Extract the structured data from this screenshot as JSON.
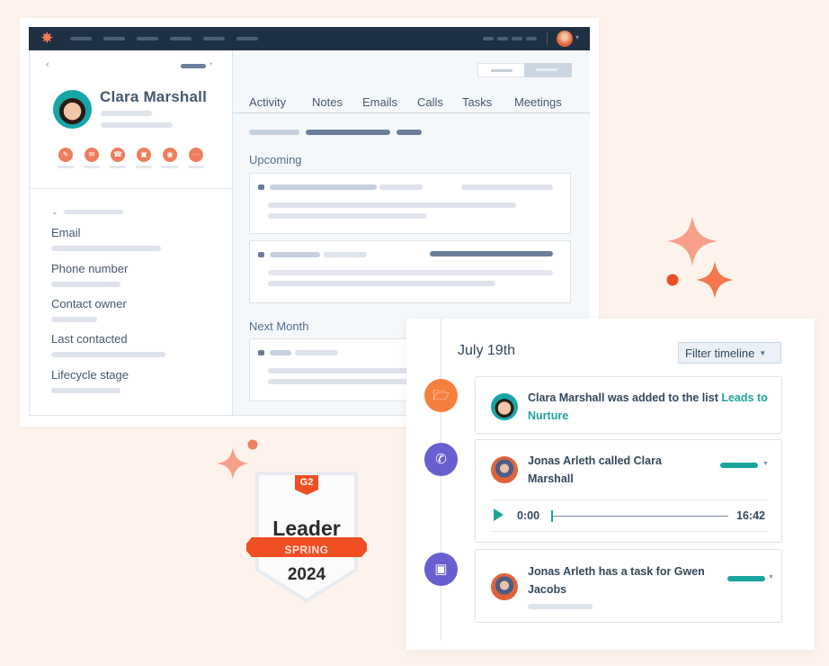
{
  "crm": {
    "logo_icon": "hubspot-sprocket-icon",
    "contact": {
      "name": "Clara Marshall",
      "action_icons": [
        "note-icon",
        "email-icon",
        "call-icon",
        "task-icon",
        "meeting-icon",
        "more-icon"
      ],
      "properties": [
        {
          "label": "Email"
        },
        {
          "label": "Phone number"
        },
        {
          "label": "Contact owner"
        },
        {
          "label": "Last contacted"
        },
        {
          "label": "Lifecycle stage"
        }
      ]
    },
    "tabs": [
      "Activity",
      "Notes",
      "Emails",
      "Calls",
      "Tasks",
      "Meetings"
    ],
    "sections": {
      "upcoming": "Upcoming",
      "next_month": "Next Month"
    }
  },
  "timeline": {
    "date": "July 19th",
    "filter_label": "Filter timeline",
    "events": [
      {
        "icon": "folder-icon",
        "icon_color": "#f5803e",
        "text": "Clara Marshall was added to the list ",
        "link": "Leads to Nurture"
      },
      {
        "icon": "phone-icon",
        "icon_color": "#6a5fd1",
        "text": "Jonas Arleth called Clara Marshall",
        "audio": {
          "current": "0:00",
          "duration": "16:42",
          "progress": 0
        }
      },
      {
        "icon": "calendar-icon",
        "icon_color": "#6a5fd1",
        "text": "Jonas Arleth has a task for Gwen Jacobs"
      }
    ]
  },
  "badge": {
    "brand": "G2",
    "title": "Leader",
    "season": "SPRING",
    "year": "2024"
  },
  "colors": {
    "background": "#fdf3ec",
    "nav": "#1f3043",
    "accent_orange": "#ef7d5b",
    "teal": "#1aa59c",
    "purple": "#6a5fd1",
    "badge_red": "#f04e23"
  }
}
